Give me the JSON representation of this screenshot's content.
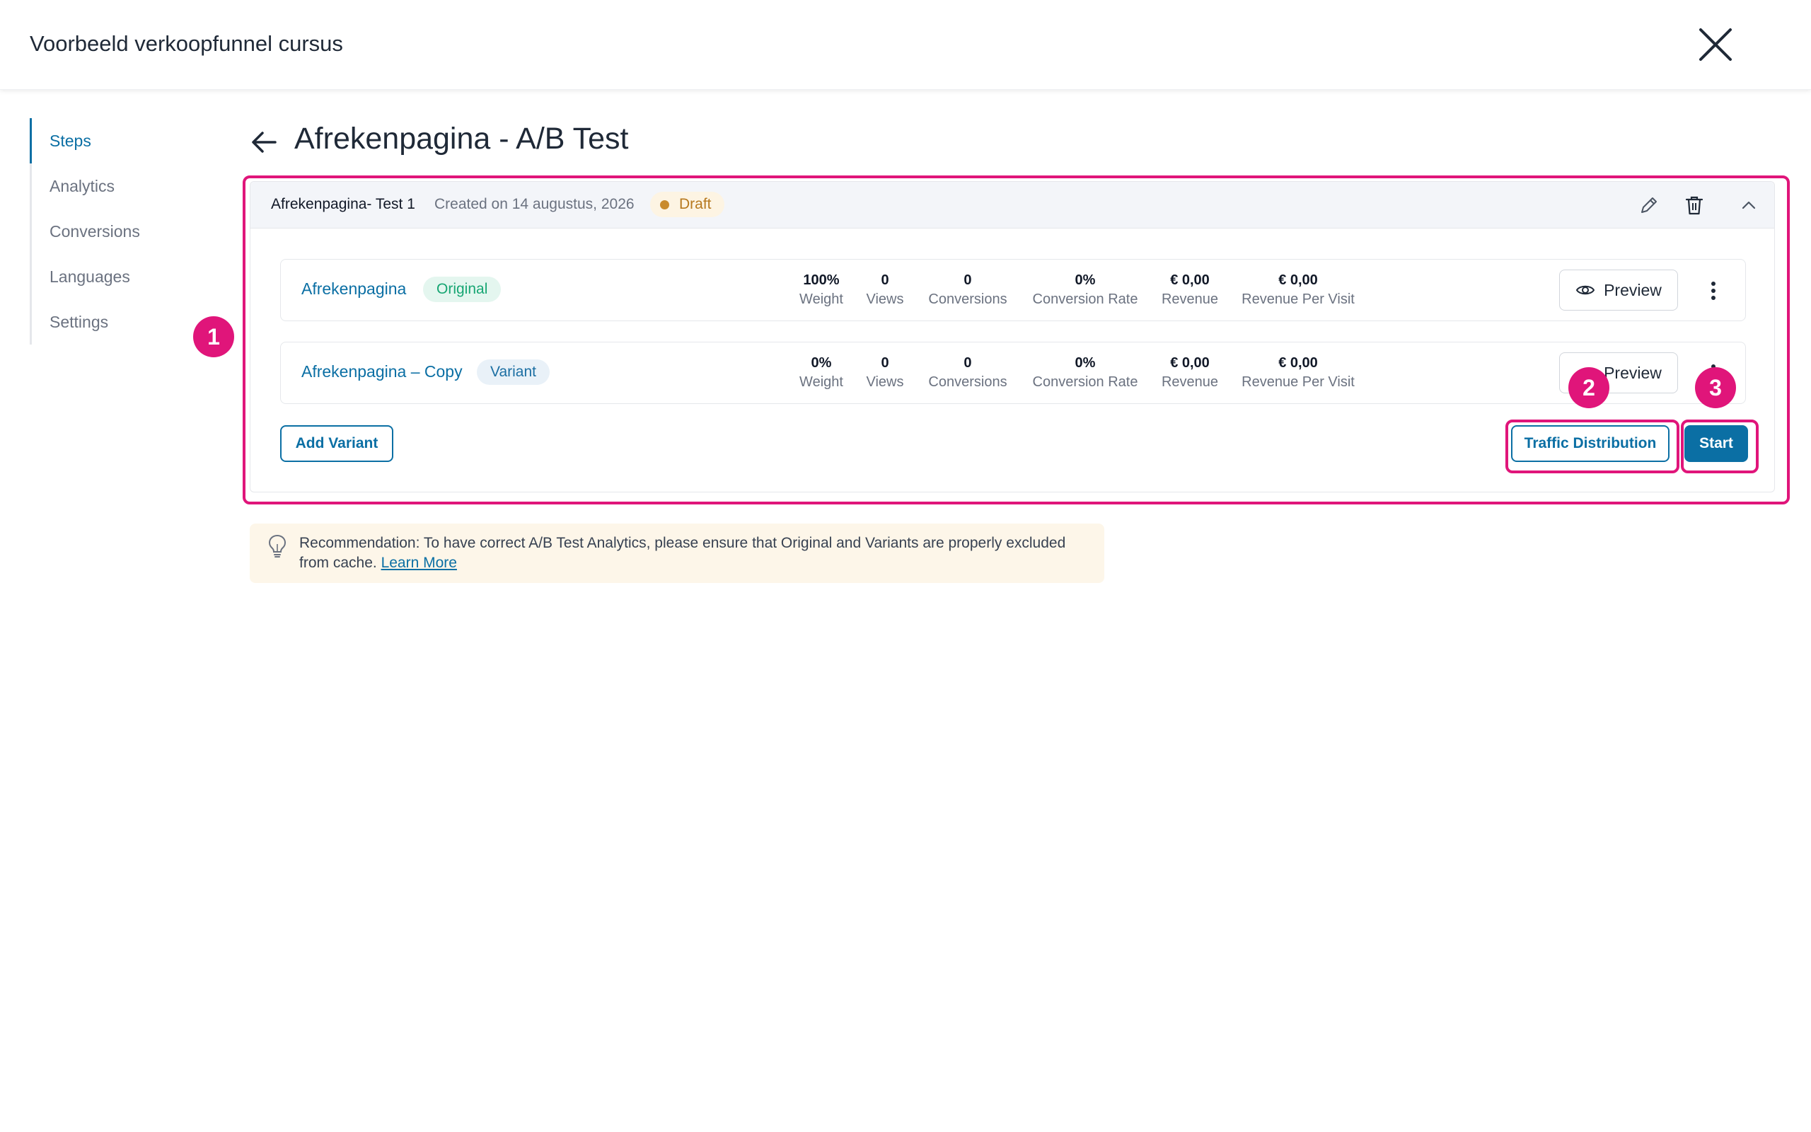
{
  "app": {
    "title": "Voorbeeld verkoopfunnel cursus"
  },
  "sidebar": {
    "items": [
      {
        "label": "Steps",
        "active": true
      },
      {
        "label": "Analytics"
      },
      {
        "label": "Conversions"
      },
      {
        "label": "Languages"
      },
      {
        "label": "Settings"
      }
    ]
  },
  "page": {
    "title": "Afrekenpagina - A/B Test"
  },
  "test": {
    "name": "Afrekenpagina- Test 1",
    "created": "Created on 14 augustus, 2026",
    "status": "Draft",
    "metric_labels": [
      "Weight",
      "Views",
      "Conversions",
      "Conversion Rate",
      "Revenue",
      "Revenue Per Visit"
    ],
    "variants": [
      {
        "name": "Afrekenpagina",
        "badge": "Original",
        "metrics": [
          "100%",
          "0",
          "0",
          "0%",
          "€ 0,00",
          "€ 0,00"
        ],
        "preview_label": "Preview"
      },
      {
        "name": "Afrekenpagina – Copy",
        "badge": "Variant",
        "metrics": [
          "0%",
          "0",
          "0",
          "0%",
          "€ 0,00",
          "€ 0,00"
        ],
        "preview_label": "Preview"
      }
    ],
    "add_variant_label": "Add Variant",
    "traffic_label": "Traffic Distribution",
    "start_label": "Start"
  },
  "recommendation": {
    "text": "Recommendation: To have correct A/B Test Analytics, please ensure that Original and Variants are properly excluded from cache.",
    "link": "Learn More"
  },
  "annotations": [
    "1",
    "2",
    "3"
  ],
  "colors": {
    "accent": "#0b6fa4",
    "highlight": "#e0157a",
    "draft": "#b7791f",
    "original": "#17a673"
  }
}
